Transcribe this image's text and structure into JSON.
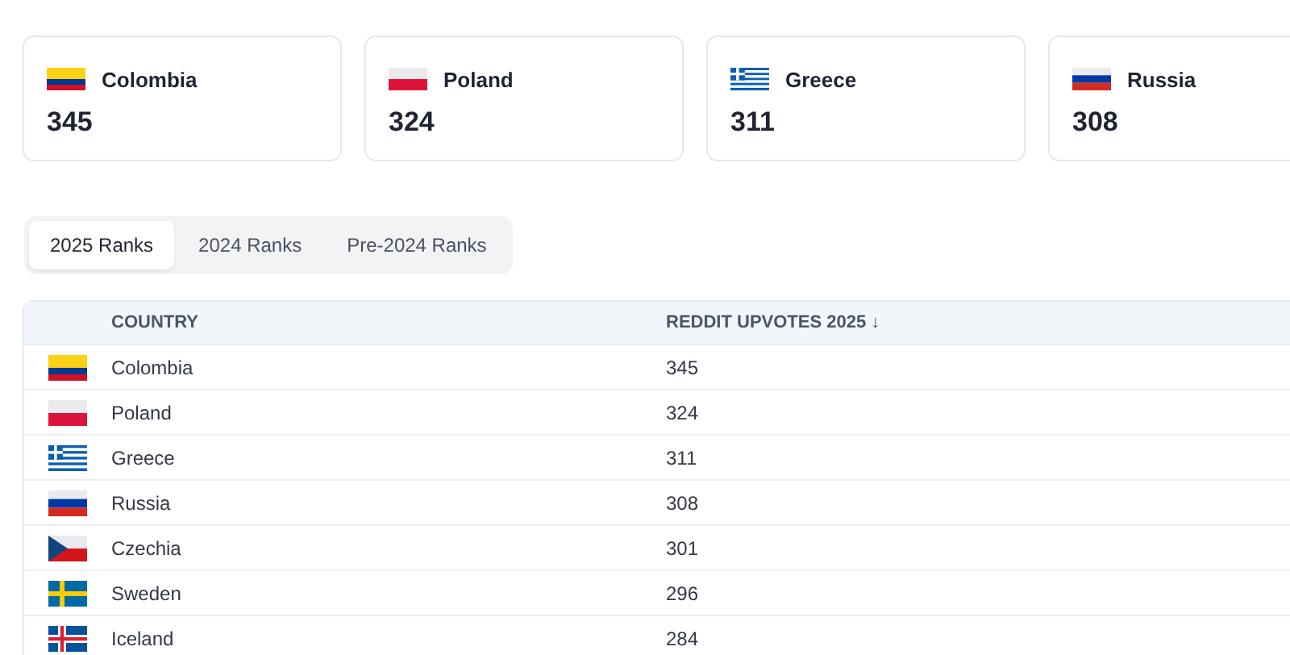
{
  "cards": [
    {
      "kind": "colombia",
      "name": "Colombia",
      "value": "345"
    },
    {
      "kind": "poland",
      "name": "Poland",
      "value": "324"
    },
    {
      "kind": "greece",
      "name": "Greece",
      "value": "311"
    },
    {
      "kind": "russia",
      "name": "Russia",
      "value": "308"
    }
  ],
  "tabs": [
    {
      "label": "2025 Ranks",
      "selected": true
    },
    {
      "label": "2024 Ranks",
      "selected": false
    },
    {
      "label": "Pre-2024 Ranks",
      "selected": false
    }
  ],
  "table": {
    "columns": [
      "COUNTRY",
      "REDDIT UPVOTES 2025 ↓"
    ],
    "rows": [
      {
        "kind": "colombia",
        "country": "Colombia",
        "upvotes": "345"
      },
      {
        "kind": "poland",
        "country": "Poland",
        "upvotes": "324"
      },
      {
        "kind": "greece",
        "country": "Greece",
        "upvotes": "311"
      },
      {
        "kind": "russia",
        "country": "Russia",
        "upvotes": "308"
      },
      {
        "kind": "czechia",
        "country": "Czechia",
        "upvotes": "301"
      },
      {
        "kind": "sweden",
        "country": "Sweden",
        "upvotes": "296"
      },
      {
        "kind": "iceland",
        "country": "Iceland",
        "upvotes": "284"
      }
    ]
  }
}
